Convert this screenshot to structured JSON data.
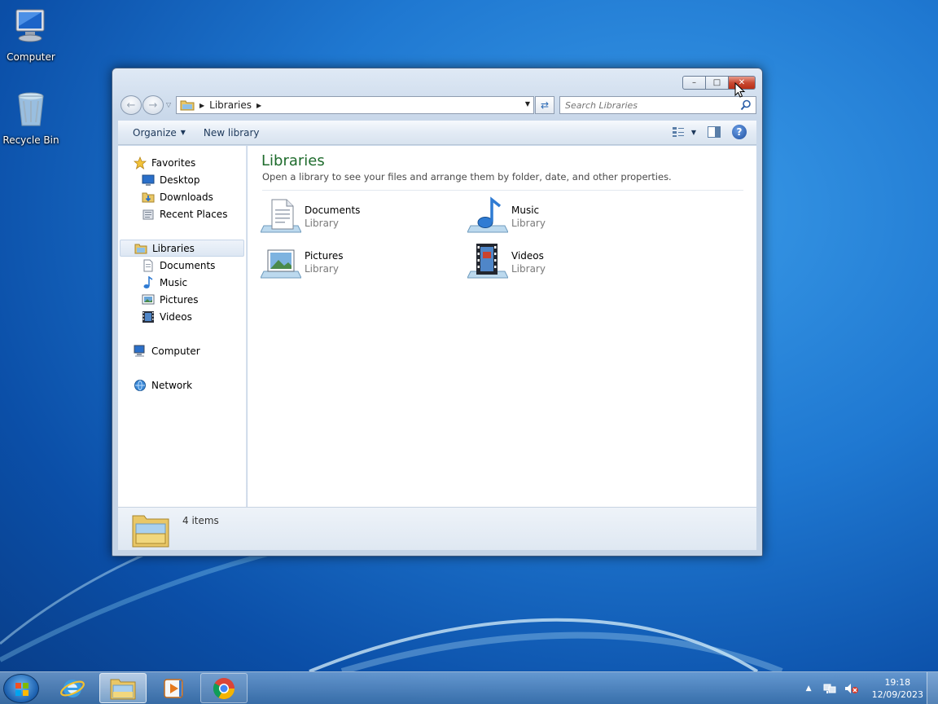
{
  "desktop": {
    "icons": [
      {
        "label": "Computer",
        "icon": "computer-icon"
      },
      {
        "label": "Recycle Bin",
        "icon": "recycle-bin-icon"
      }
    ]
  },
  "window": {
    "address": {
      "crumb": "Libraries"
    },
    "search": {
      "placeholder": "Search Libraries"
    },
    "toolbar": {
      "organize_label": "Organize",
      "new_library_label": "New library"
    },
    "nav": {
      "favorites": "Favorites",
      "desktop": "Desktop",
      "downloads": "Downloads",
      "recent_places": "Recent Places",
      "libraries": "Libraries",
      "documents": "Documents",
      "music": "Music",
      "pictures": "Pictures",
      "videos": "Videos",
      "computer": "Computer",
      "network": "Network"
    },
    "content": {
      "title": "Libraries",
      "subtitle": "Open a library to see your files and arrange them by folder, date, and other properties.",
      "items": [
        {
          "name": "Documents",
          "kind": "Library"
        },
        {
          "name": "Music",
          "kind": "Library"
        },
        {
          "name": "Pictures",
          "kind": "Library"
        },
        {
          "name": "Videos",
          "kind": "Library"
        }
      ]
    },
    "details": {
      "count": "4 items"
    }
  },
  "taskbar": {
    "clock": {
      "time": "19:18",
      "date": "12/09/2023"
    }
  },
  "colors": {
    "title_green": "#1e6b2c",
    "close_red": "#c94a33",
    "desktop_blue": "#1f78d1"
  }
}
